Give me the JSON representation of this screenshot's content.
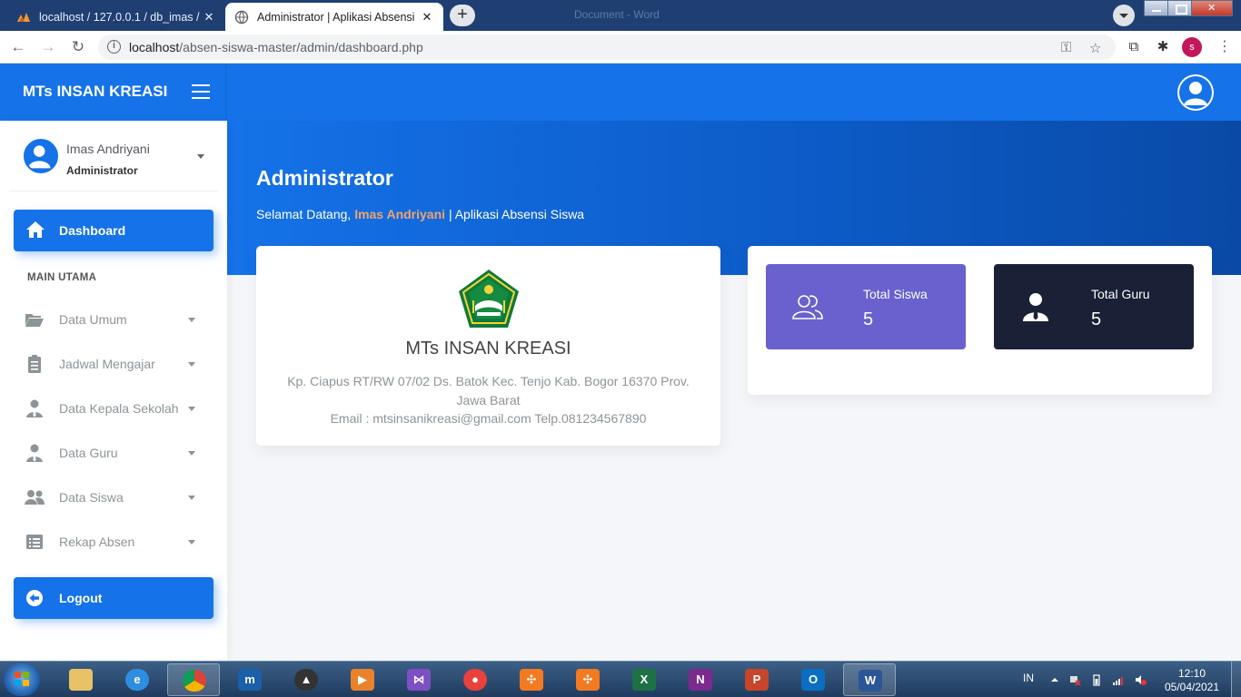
{
  "browser": {
    "tabs": [
      {
        "title": "localhost / 127.0.0.1 / db_imas / t"
      },
      {
        "title": "Administrator | Aplikasi Absensi"
      }
    ],
    "window_title": "Document - Word",
    "url_host": "localhost",
    "url_path": "/absen-siswa-master/admin/dashboard.php",
    "profile_initial": "s"
  },
  "app": {
    "brand": "MTs INSAN KREASI",
    "user": {
      "name": "Imas Andriyani",
      "role": "Administrator"
    },
    "nav": {
      "active": {
        "label": "Dashboard",
        "icon": "home-icon"
      },
      "section": "MAIN UTAMA",
      "items": [
        {
          "label": "Data Umum",
          "icon": "folder-open-icon"
        },
        {
          "label": "Jadwal Mengajar",
          "icon": "clipboard-icon"
        },
        {
          "label": "Data Kepala Sekolah",
          "icon": "user-tie-icon"
        },
        {
          "label": "Data Guru",
          "icon": "user-tie-icon"
        },
        {
          "label": "Data Siswa",
          "icon": "users-icon"
        },
        {
          "label": "Rekap Absen",
          "icon": "list-icon"
        }
      ],
      "logout": {
        "label": "Logout",
        "icon": "arrow-left-circle-icon"
      }
    },
    "page": {
      "title": "Administrator",
      "welcome_prefix": "Selamat Datang,",
      "welcome_name": "Imas Andriyani",
      "welcome_suffix": "| Aplikasi Absensi Siswa"
    },
    "school": {
      "name": "MTs INSAN KREASI",
      "address": "Kp. Ciapus RT/RW 07/02 Ds. Batok Kec. Tenjo Kab. Bogor 16370 Prov. Jawa Barat",
      "contact": "Email : mtsinsanikreasi@gmail.com Telp.081234567890"
    },
    "stats": [
      {
        "label": "Total Siswa",
        "value": "5",
        "color": "#6861ce",
        "icon": "users-outline-icon"
      },
      {
        "label": "Total Guru",
        "value": "5",
        "color": "#1a2035",
        "icon": "user-tie-icon"
      }
    ],
    "colors": {
      "primary": "#1572e8",
      "accent": "#f2a36b"
    }
  },
  "taskbar": {
    "apps": [
      "explorer",
      "internet-explorer",
      "chrome",
      "mobaxterm",
      "inkscape",
      "media-player",
      "visual-studio",
      "screen-recorder",
      "xampp",
      "xampp",
      "excel",
      "onenote",
      "powerpoint",
      "outlook",
      "word"
    ],
    "language": "IN",
    "time": "12:10",
    "date": "05/04/2021"
  }
}
